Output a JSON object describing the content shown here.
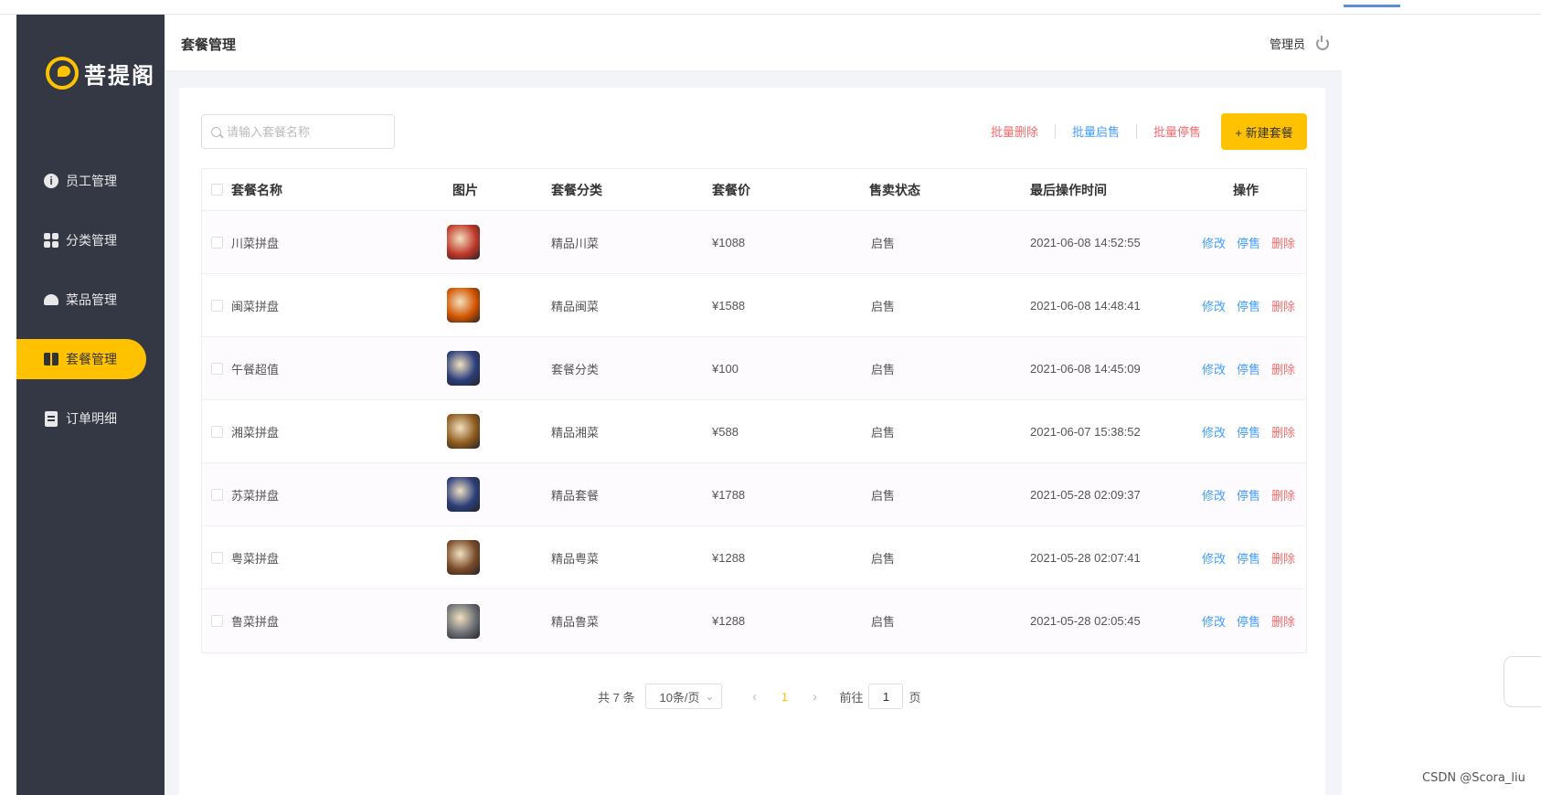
{
  "app": {
    "logo_text": "菩提阁"
  },
  "sidebar": {
    "items": [
      {
        "label": "员工管理",
        "icon": "info-icon",
        "active": false
      },
      {
        "label": "分类管理",
        "icon": "grid-icon",
        "active": false
      },
      {
        "label": "菜品管理",
        "icon": "cloche-icon",
        "active": false
      },
      {
        "label": "套餐管理",
        "icon": "gift-icon",
        "active": true
      },
      {
        "label": "订单明细",
        "icon": "clipboard-icon",
        "active": false
      }
    ]
  },
  "header": {
    "title": "套餐管理",
    "user": "管理员"
  },
  "toolbar": {
    "search_placeholder": "请输入套餐名称",
    "batch_delete": "批量删除",
    "batch_enable": "批量启售",
    "batch_disable": "批量停售",
    "new_button": "+ 新建套餐"
  },
  "table": {
    "columns": [
      "套餐名称",
      "图片",
      "套餐分类",
      "套餐价",
      "售卖状态",
      "最后操作时间",
      "操作"
    ],
    "op_labels": {
      "edit": "修改",
      "toggle": "停售",
      "delete": "删除"
    },
    "rows": [
      {
        "name": "川菜拼盘",
        "category": "精品川菜",
        "price": "¥1088",
        "status": "启售",
        "time": "2021-06-08 14:52:55",
        "thumb": "#c0392b"
      },
      {
        "name": "闽菜拼盘",
        "category": "精品闽菜",
        "price": "¥1588",
        "status": "启售",
        "time": "2021-06-08 14:48:41",
        "thumb": "#d35400"
      },
      {
        "name": "午餐超值",
        "category": "套餐分类",
        "price": "¥100",
        "status": "启售",
        "time": "2021-06-08 14:45:09",
        "thumb": "#2c3e7a"
      },
      {
        "name": "湘菜拼盘",
        "category": "精品湘菜",
        "price": "¥588",
        "status": "启售",
        "time": "2021-06-07 15:38:52",
        "thumb": "#8e5a1e"
      },
      {
        "name": "苏菜拼盘",
        "category": "精品套餐",
        "price": "¥1788",
        "status": "启售",
        "time": "2021-05-28 02:09:37",
        "thumb": "#2c3e7a"
      },
      {
        "name": "粤菜拼盘",
        "category": "精品粤菜",
        "price": "¥1288",
        "status": "启售",
        "time": "2021-05-28 02:07:41",
        "thumb": "#7a4a2a"
      },
      {
        "name": "鲁菜拼盘",
        "category": "精品鲁菜",
        "price": "¥1288",
        "status": "启售",
        "time": "2021-05-28 02:05:45",
        "thumb": "#6b6e74"
      }
    ]
  },
  "pagination": {
    "total": "共 7 条",
    "page_size": "10条/页",
    "current": "1",
    "goto_label": "前往",
    "goto_value": "1",
    "page_suffix": "页"
  },
  "watermark": "CSDN @Scora_liu"
}
